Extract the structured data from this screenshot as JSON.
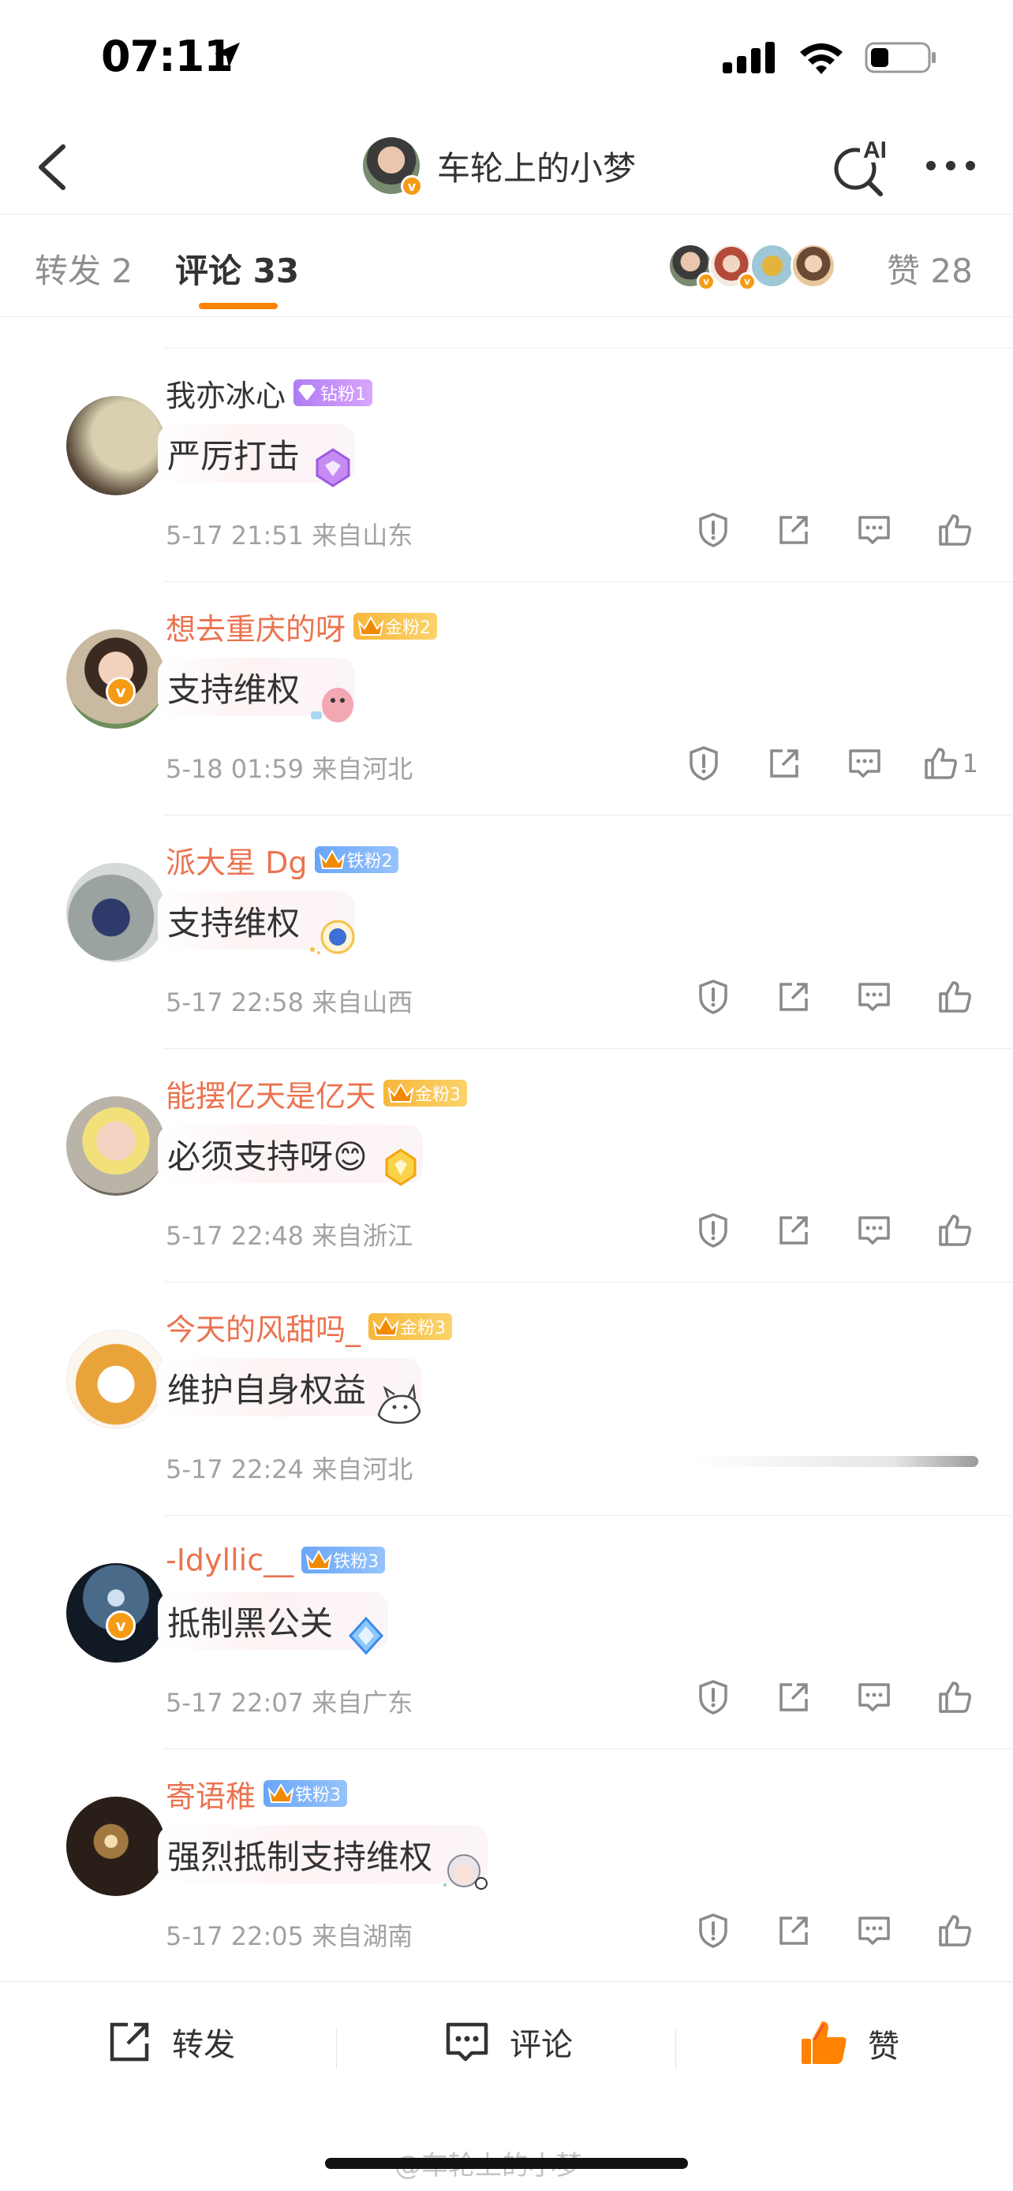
{
  "status_bar": {
    "time": "07:11"
  },
  "header": {
    "title": "车轮上的小梦",
    "ai_label": "AI"
  },
  "tabs": {
    "repost": "转发 2",
    "comment": "评论 33",
    "like": "赞 28"
  },
  "comments": [
    {
      "name": "我亦冰心",
      "fan_badge": "钻粉1",
      "badge_type": "diamond",
      "text": "严厉打击",
      "meta": "5-17 21:51 来自山东",
      "like_count": "",
      "name_orange": false
    },
    {
      "name": "想去重庆的呀",
      "fan_badge": "金粉2",
      "badge_type": "gold",
      "crown_level": "4",
      "text": "支持维权",
      "meta": "5-18 01:59 来自河北",
      "like_count": "1",
      "name_orange": true
    },
    {
      "name": "派大星 Dg",
      "fan_badge": "铁粉2",
      "badge_type": "iron",
      "crown_level": "6",
      "text": "支持维权",
      "meta": "5-17 22:58 来自山西",
      "like_count": "",
      "name_orange": true
    },
    {
      "name": "能摆亿天是亿天",
      "fan_badge": "金粉3",
      "badge_type": "gold",
      "crown_level": "4",
      "text": "必须支持呀😊",
      "meta": "5-17 22:48 来自浙江",
      "like_count": "",
      "name_orange": true
    },
    {
      "name": "今天的风甜吗_",
      "fan_badge": "金粉3",
      "badge_type": "gold",
      "crown_level": "5",
      "text": "维护自身权益",
      "meta": "5-17 22:24 来自河北",
      "like_count": "",
      "name_orange": true
    },
    {
      "name": "-Idyllic__",
      "fan_badge": "铁粉3",
      "badge_type": "iron",
      "crown_level": "5",
      "text": "抵制黑公关",
      "meta": "5-17 22:07 来自广东",
      "like_count": "",
      "name_orange": true
    },
    {
      "name": "寄语稚",
      "fan_badge": "铁粉3",
      "badge_type": "iron",
      "crown_level": "2",
      "text": "强烈抵制支持维权",
      "meta": "5-17 22:05 来自湖南",
      "like_count": "",
      "name_orange": true
    }
  ],
  "bottom_bar": {
    "repost": "转发",
    "comment": "评论",
    "like": "赞"
  },
  "watermark": "@车轮上的小梦",
  "colors": {
    "accent": "#ff8200",
    "name_orange": "#eb7350"
  }
}
